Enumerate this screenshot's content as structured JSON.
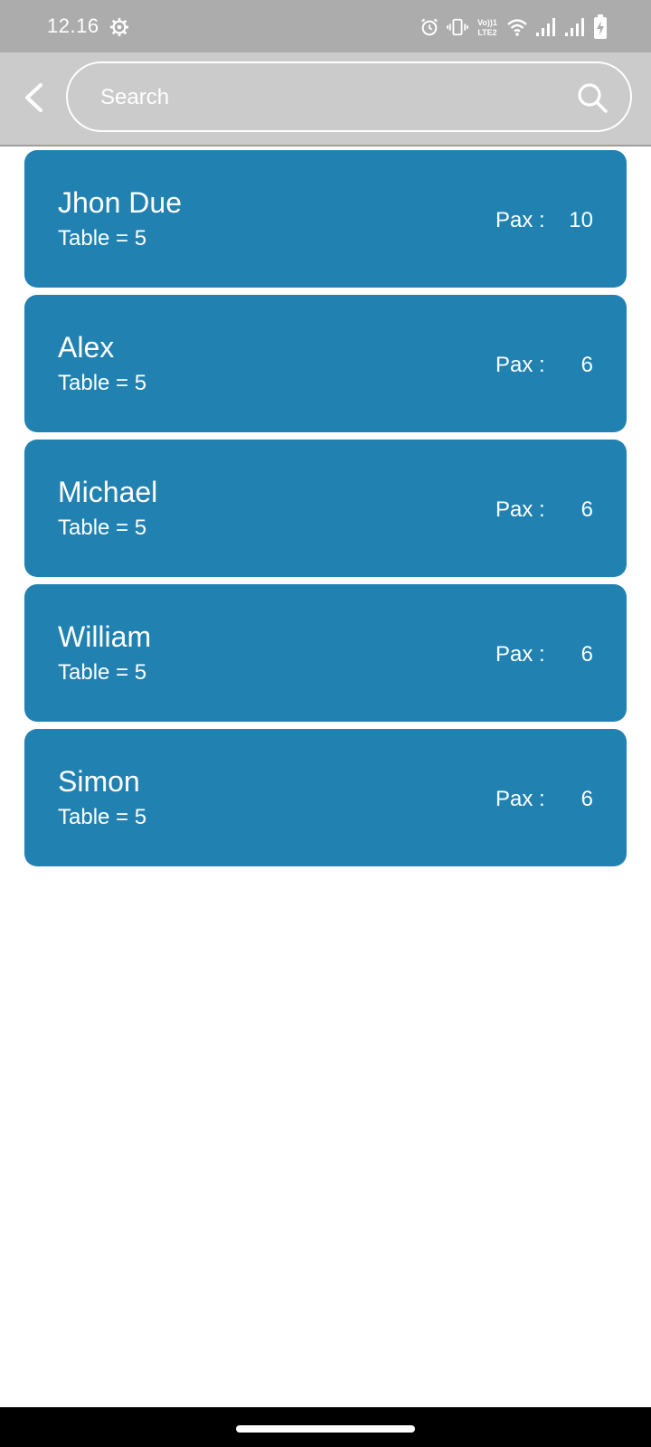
{
  "status_bar": {
    "time": "12.16",
    "icons": [
      "settings-icon",
      "alarm-icon",
      "vibrate-icon",
      "volte-icon",
      "wifi-icon",
      "signal-1-icon",
      "signal-2-icon",
      "battery-charging-icon"
    ],
    "volte_line1": "Vo))1",
    "volte_line2": "LTE2"
  },
  "header": {
    "back_icon": "chevron-left-icon",
    "search_placeholder": "Search",
    "search_icon": "search-icon"
  },
  "guests": [
    {
      "name": "Jhon Due",
      "table": "Table = 5",
      "pax_label": "Pax :",
      "pax": "10"
    },
    {
      "name": "Alex",
      "table": "Table = 5",
      "pax_label": "Pax :",
      "pax": "6"
    },
    {
      "name": "Michael",
      "table": "Table = 5",
      "pax_label": "Pax :",
      "pax": "6"
    },
    {
      "name": "William",
      "table": "Table = 5",
      "pax_label": "Pax :",
      "pax": "6"
    },
    {
      "name": "Simon",
      "table": "Table = 5",
      "pax_label": "Pax :",
      "pax": "6"
    }
  ],
  "colors": {
    "status_bar": "#acacac",
    "header": "#cbcbcb",
    "card": "#2182b1",
    "text": "#ffffff",
    "background": "#ffffff",
    "nav_bar": "#000000"
  }
}
